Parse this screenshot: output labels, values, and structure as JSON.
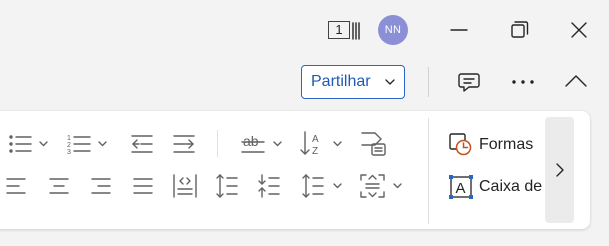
{
  "title_bar": {
    "pages_indicator_value": "1",
    "avatar_initials": "NN"
  },
  "share": {
    "share_label": "Partilhar"
  },
  "ribbon": {
    "shapes_label": "Formas",
    "textbox_label": "Caixa de"
  },
  "colors": {
    "window_bg": "#f3f3f3",
    "ribbon_bg": "#ffffff",
    "accent_blue": "#2b65c5",
    "avatar_bg": "#8b8fd6",
    "shape_accent": "#c4501b"
  },
  "icons": [
    "pages-indicator-icon",
    "minimize-icon",
    "restore-icon",
    "close-icon",
    "chevron-down-icon",
    "comment-icon",
    "more-icon",
    "chevron-up-icon",
    "bullets-icon",
    "numbering-icon",
    "decrease-indent-icon",
    "increase-indent-icon",
    "strikethrough-ab-icon",
    "sort-az-icon",
    "styles-pane-icon",
    "align-left-icon",
    "align-center-icon",
    "align-right-icon",
    "justify-icon",
    "columns-icon",
    "line-spacing-icon",
    "paragraph-spacing-icon",
    "spacing-icon",
    "text-frame-icon",
    "shapes-icon",
    "textbox-icon",
    "chevron-right-icon"
  ]
}
